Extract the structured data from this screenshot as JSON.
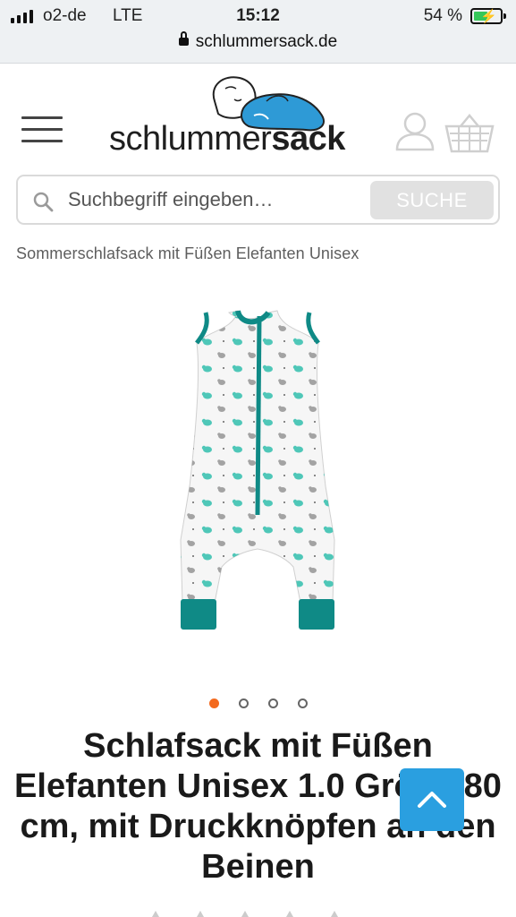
{
  "status_bar": {
    "carrier": "o2-de",
    "network": "LTE",
    "time": "15:12",
    "battery_percent": "54 %",
    "battery_level": 0.54,
    "signal_bars": 4
  },
  "browser": {
    "url": "schlummersack.de"
  },
  "header": {
    "logo_text_regular": "schlummer",
    "logo_text_bold": "sack",
    "icons": {
      "menu": "hamburger-menu-icon",
      "account": "user-icon",
      "cart": "shopping-basket-icon"
    }
  },
  "search": {
    "placeholder": "Suchbegriff eingeben…",
    "button_label": "SUCHE"
  },
  "breadcrumb": "Sommerschlafsack mit Füßen Elefanten Unisex",
  "gallery": {
    "slide_count": 4,
    "active_index": 0
  },
  "product": {
    "title": "Schlafsack mit Füßen Elefanten Unisex 1.0 Größe 80 cm, mit Druckknöpfen an den Beinen"
  },
  "colors": {
    "accent_orange": "#f36a1f",
    "back_to_top_blue": "#2a9fe0",
    "garment_teal": "#0f8a86",
    "search_button_gray": "#e1e1e1"
  }
}
